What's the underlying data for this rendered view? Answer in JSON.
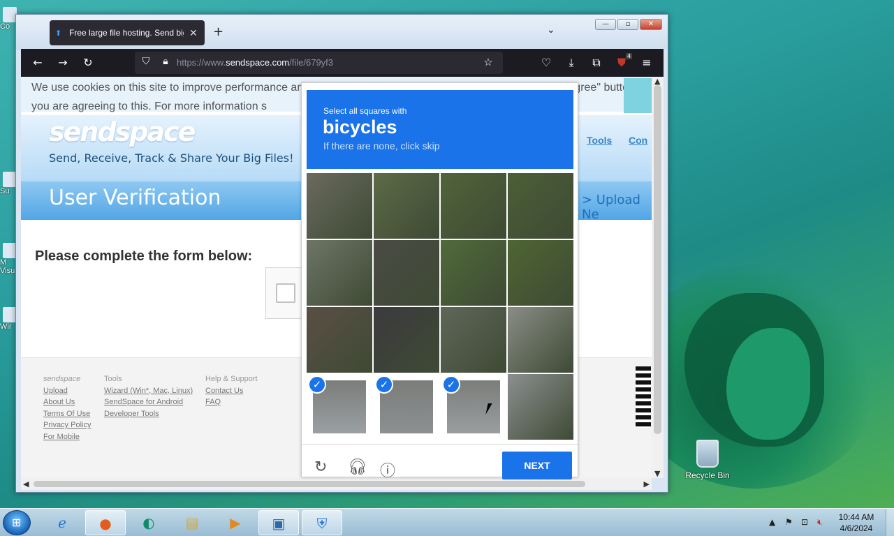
{
  "desktop": {
    "recycle_bin_label": "Recycle Bin",
    "left_icons": [
      "Co",
      "Su",
      "M\nVisu",
      "Wir"
    ]
  },
  "browser": {
    "tab_title": "Free large file hosting. Send big",
    "new_tab": "+",
    "tab_list": "⌄",
    "url_prefix": "https://www.",
    "url_domain": "sendspace.com",
    "url_path": "/file/679yf3",
    "extension_badge": "4"
  },
  "page": {
    "cookie_text": "We use cookies on this site to improve performance and for analytics. By browsing this site, or clicking the \"I agree\" button, you are agreeing to this. For more information s",
    "logo": "sendspace",
    "tagline": "Send, Receive, Track & Share Your Big Files!",
    "heading": "User Verification",
    "nav_tools": "Tools",
    "nav_con": "Con",
    "upload_new": "> Upload Ne",
    "form_title": "Please complete the form below:",
    "footer": {
      "col1": {
        "heading": "sendspace",
        "links": [
          "Upload",
          "About Us",
          "Terms Of Use",
          "Privacy Policy",
          "For Mobile"
        ]
      },
      "col2": {
        "heading": "Tools",
        "links": [
          "Wizard (Win*, Mac, Linux)",
          "SendSpace for Android",
          "Developer Tools"
        ]
      },
      "col3": {
        "heading": "Help & Support",
        "links": [
          "Contact Us",
          "FAQ"
        ]
      }
    }
  },
  "captcha": {
    "instruction": "Select all squares with",
    "target": "bicycles",
    "hint": "If there are none, click skip",
    "next_label": "NEXT",
    "selected_tiles": [
      12,
      13,
      14
    ]
  },
  "taskbar": {
    "time": "10:44 AM",
    "date": "4/6/2024"
  }
}
